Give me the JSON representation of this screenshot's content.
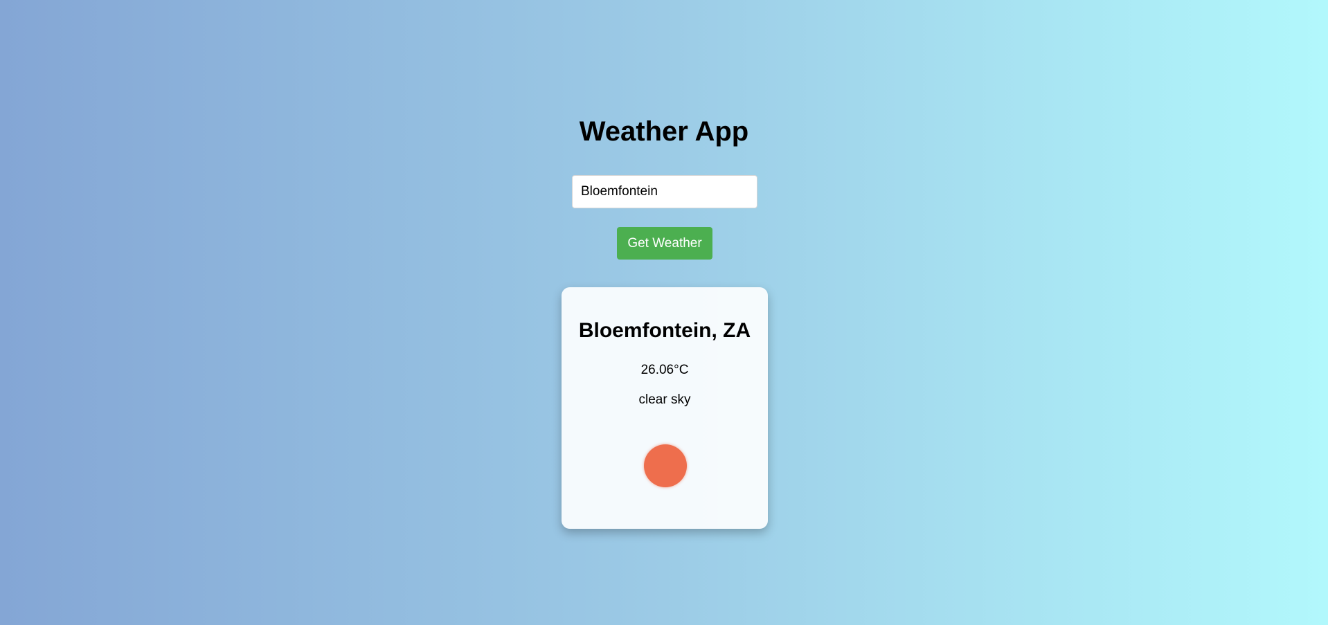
{
  "app": {
    "title": "Weather App"
  },
  "search": {
    "value": "Bloemfontein",
    "button_label": "Get Weather"
  },
  "weather_card": {
    "location": "Bloemfontein, ZA",
    "temperature": "26.06°C",
    "description": "clear sky",
    "icon": "sun-icon",
    "icon_color": "#ee6e4d"
  },
  "colors": {
    "background_gradient_start": "#84a6d5",
    "background_gradient_end": "#b2f8fc",
    "button": "#4caf50",
    "button_text": "#ffffff",
    "card_background": "#f3f8fb"
  }
}
